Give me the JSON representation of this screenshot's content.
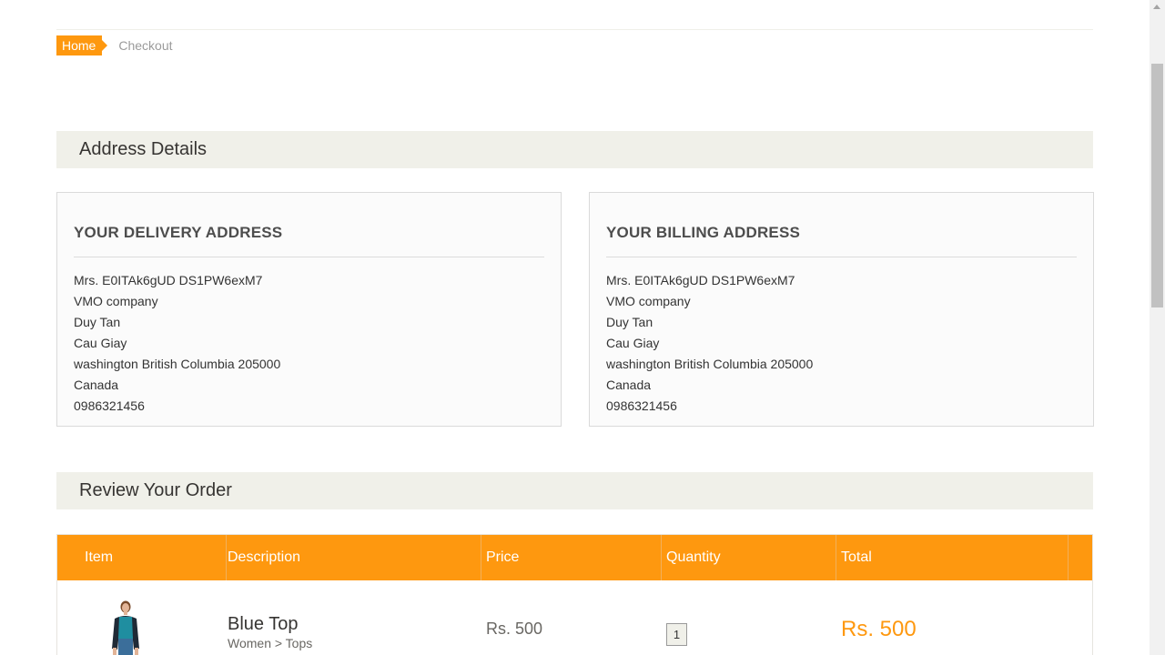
{
  "breadcrumb": {
    "home": "Home",
    "current": "Checkout"
  },
  "address_section": {
    "title": "Address Details",
    "delivery": {
      "title": "YOUR DELIVERY ADDRESS",
      "lines": [
        "Mrs. E0ITAk6gUD DS1PW6exM7",
        "VMO company",
        "Duy Tan",
        "Cau Giay",
        "washington British Columbia 205000",
        "Canada",
        "0986321456"
      ]
    },
    "billing": {
      "title": "YOUR BILLING ADDRESS",
      "lines": [
        "Mrs. E0ITAk6gUD DS1PW6exM7",
        "VMO company",
        "Duy Tan",
        "Cau Giay",
        "washington British Columbia 205000",
        "Canada",
        "0986321456"
      ]
    }
  },
  "review_section": {
    "title": "Review Your Order",
    "headers": [
      "Item",
      "Description",
      "Price",
      "Quantity",
      "Total"
    ],
    "items": [
      {
        "image_icon": "product-woman-blue-top-icon",
        "name": "Blue Top",
        "category": "Women > Tops",
        "price": "Rs. 500",
        "quantity": "1",
        "total": "Rs. 500"
      }
    ]
  },
  "colors": {
    "accent": "#fe980f",
    "section_bg": "#f0f0e9"
  }
}
